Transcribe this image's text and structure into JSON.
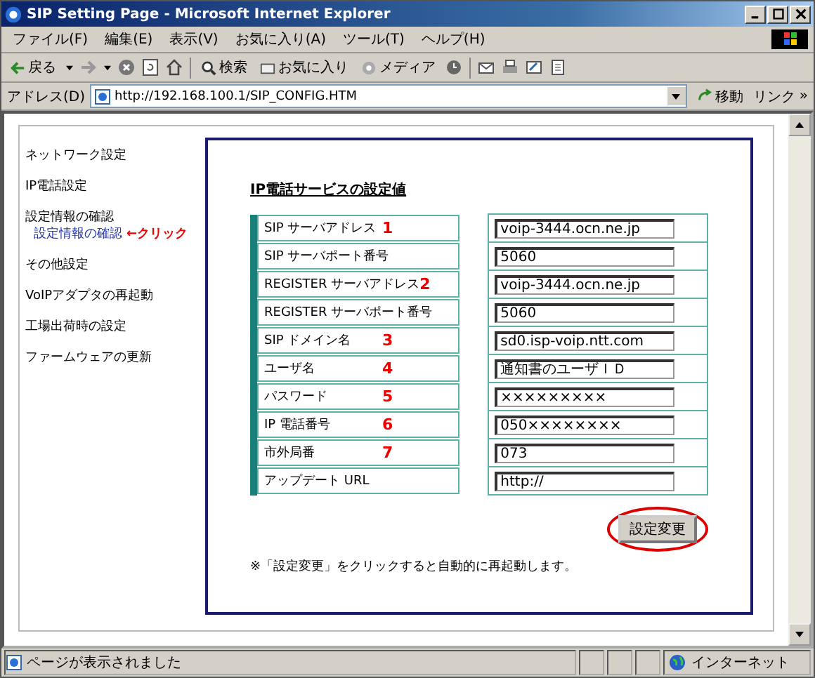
{
  "window": {
    "title": "SIP Setting Page - Microsoft Internet Explorer"
  },
  "menu": [
    "ファイル(F)",
    "編集(E)",
    "表示(V)",
    "お気に入り(A)",
    "ツール(T)",
    "ヘルプ(H)"
  ],
  "toolbar": {
    "back": "戻る",
    "search": "検索",
    "favorites": "お気に入り",
    "media": "メディア"
  },
  "address": {
    "label": "アドレス(D)",
    "value": "http://192.168.100.1/SIP_CONFIG.HTM",
    "go": "移動",
    "links": "リンク",
    "more": "»"
  },
  "sidebar": {
    "items": [
      {
        "label": "ネットワーク設定"
      },
      {
        "label": "IP電話設定"
      },
      {
        "label": "設定情報の確認",
        "children": [
          {
            "label": "設定情報の確認",
            "annotation": "←クリック"
          }
        ]
      },
      {
        "label": "その他設定"
      },
      {
        "label": "VoIPアダプタの再起動"
      },
      {
        "label": "工場出荷時の設定"
      },
      {
        "label": "ファームウェアの更新"
      }
    ]
  },
  "form": {
    "title": "IP電話サービスの設定値",
    "fields": [
      {
        "label": "SIP サーバアドレス",
        "number": "1",
        "value": "voip-3444.ocn.ne.jp"
      },
      {
        "label": "SIP サーバポート番号",
        "value": "5060"
      },
      {
        "label": "REGISTER サーバアドレス",
        "number": "2",
        "value": "voip-3444.ocn.ne.jp"
      },
      {
        "label": "REGISTER サーバポート番号",
        "value": "5060"
      },
      {
        "label": "SIP ドメイン名",
        "number": "3",
        "value": "sd0.isp-voip.ntt.com"
      },
      {
        "label": "ユーザ名",
        "number": "4",
        "value": "通知書のユーザＩＤ"
      },
      {
        "label": "パスワード",
        "number": "5",
        "value": "×××××××××"
      },
      {
        "label": "IP 電話番号",
        "number": "6",
        "value": "050××××××××"
      },
      {
        "label": "市外局番",
        "number": "7",
        "value": "073"
      },
      {
        "label": "アップデート URL",
        "value": "http://"
      }
    ],
    "button": {
      "label": "設定変更",
      "circled": true
    },
    "note": "※「設定変更」をクリックすると自動的に再起動します。"
  },
  "status_bar": {
    "text": "ページが表示されました",
    "zone": "インターネット"
  }
}
